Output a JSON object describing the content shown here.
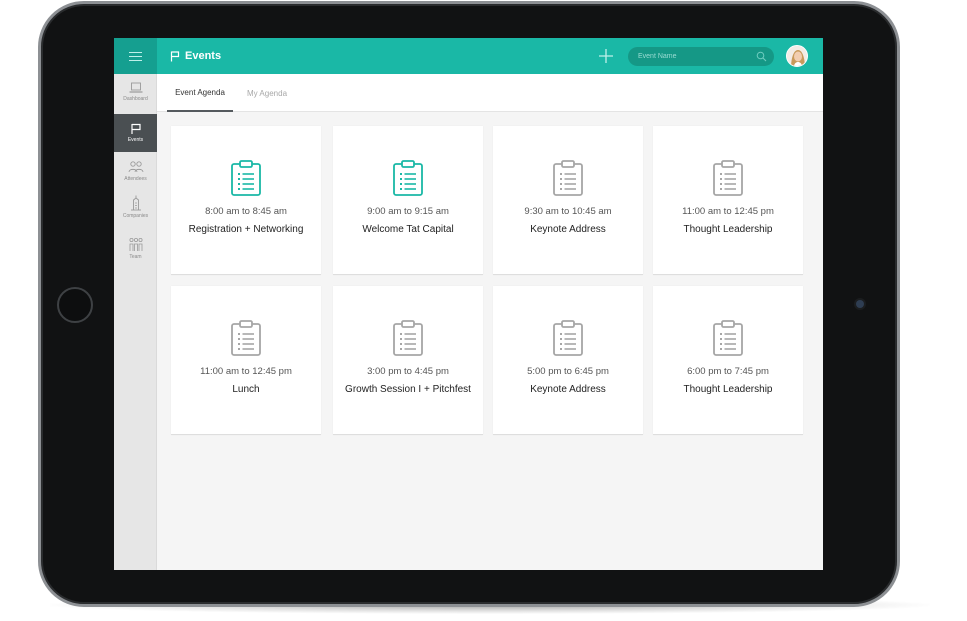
{
  "header": {
    "title": "Events",
    "search_placeholder": "Event Name"
  },
  "sidebar": {
    "items": [
      {
        "label": "Dashboard",
        "icon": "laptop-icon",
        "active": false
      },
      {
        "label": "Events",
        "icon": "flag-icon",
        "active": true
      },
      {
        "label": "Attendees",
        "icon": "people-icon",
        "active": false
      },
      {
        "label": "Companies",
        "icon": "building-icon",
        "active": false
      },
      {
        "label": "Team",
        "icon": "team-icon",
        "active": false
      }
    ]
  },
  "tabs": [
    {
      "label": "Event Agenda",
      "active": true
    },
    {
      "label": "My Agenda",
      "active": false
    }
  ],
  "events": [
    {
      "time": "8:00 am to 8:45 am",
      "title": "Registration + Networking",
      "highlighted": true
    },
    {
      "time": "9:00 am to 9:15 am",
      "title": "Welcome Tat Capital",
      "highlighted": true
    },
    {
      "time": "9:30 am to 10:45 am",
      "title": "Keynote Address",
      "highlighted": false
    },
    {
      "time": "11:00 am to 12:45 pm",
      "title": "Thought Leadership",
      "highlighted": false
    },
    {
      "time": "11:00 am to 12:45 pm",
      "title": "Lunch",
      "highlighted": false
    },
    {
      "time": "3:00 pm to 4:45 pm",
      "title": "Growth Session I + Pitchfest",
      "highlighted": false
    },
    {
      "time": "5:00 pm to 6:45 pm",
      "title": "Keynote Address",
      "highlighted": false
    },
    {
      "time": "6:00 pm to 7:45 pm",
      "title": "Thought Leadership",
      "highlighted": false
    }
  ],
  "colors": {
    "accent": "#1ab8a6",
    "accent_dark": "#159f90",
    "icon_highlight": "#1ab8a6",
    "icon_muted": "#a6a6a6"
  }
}
